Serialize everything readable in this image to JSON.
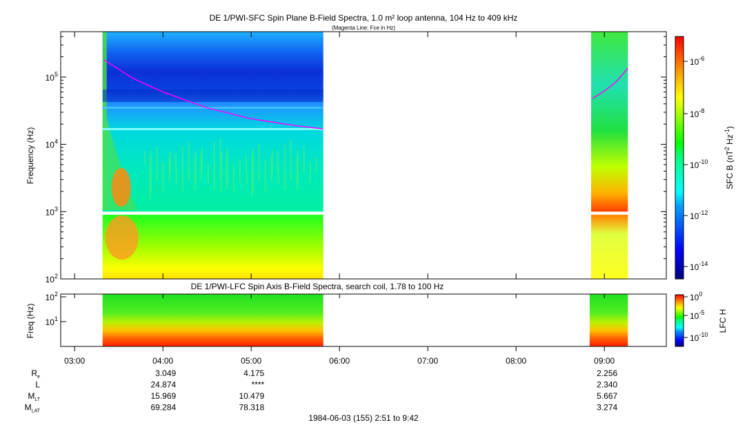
{
  "chart_data": [
    {
      "type": "heatmap",
      "title": "DE 1/PWI-SFC  Spin Plane B-Field Spectra, 1.0 m² loop antenna, 104 Hz to 409 kHz",
      "subtitle": "(Magenta Line: Fce in Hz)",
      "ylabel": "Frequency (Hz)",
      "yscale": "log",
      "ylim": [
        100,
        409000
      ],
      "ytick_labels": [
        "10^2",
        "10^3",
        "10^4",
        "10^5"
      ],
      "ytick_values": [
        100,
        1000,
        10000,
        100000
      ],
      "data_intervals": [
        [
          "03:19",
          "05:49"
        ],
        [
          "08:51",
          "09:16"
        ]
      ],
      "gap_hz": [
        900,
        1000
      ],
      "fce_line": {
        "color": "#ff00ff",
        "segments": [
          [
            [
              "03:20",
              180000
            ],
            [
              "03:40",
              95000
            ],
            [
              "04:00",
              60000
            ],
            [
              "04:30",
              35000
            ],
            [
              "05:00",
              24000
            ],
            [
              "05:30",
              19000
            ],
            [
              "05:49",
              17000
            ]
          ],
          [
            [
              "08:52",
              48000
            ],
            [
              "09:00",
              62000
            ],
            [
              "09:08",
              85000
            ],
            [
              "09:16",
              135000
            ]
          ]
        ]
      },
      "colorbar": {
        "label": "SFC B (nT² Hz⁻¹)",
        "label_main": "SFC B (nT",
        "label_sup1": "2",
        "label_mid": " Hz",
        "label_sup2": "-1",
        "label_end": ")",
        "scale": "log",
        "range": [
          1e-15,
          1e-05
        ],
        "tick_labels": [
          "10^-6",
          "10^-8",
          "10^-10",
          "10^-12",
          "10^-14"
        ]
      }
    },
    {
      "type": "heatmap",
      "title": "DE 1/PWI-LFC  Spin Axis B-Field Spectra, search coil, 1.78 to 100 Hz",
      "ylabel": "Freq (Hz)",
      "yscale": "log",
      "ylim": [
        1.78,
        100
      ],
      "ytick_labels": [
        "10^2",
        "10^1"
      ],
      "data_intervals": [
        [
          "03:19",
          "05:49"
        ],
        [
          "08:50",
          "09:16"
        ]
      ],
      "colorbar": {
        "label": "LFC H",
        "scale": "log",
        "range": [
          1e-12,
          1
        ],
        "tick_labels": [
          "10^0",
          "10^-5",
          "10^-10"
        ]
      }
    }
  ],
  "xaxis": {
    "range": [
      "02:51",
      "09:42"
    ],
    "tick_labels": [
      "03:00",
      "04:00",
      "05:00",
      "06:00",
      "07:00",
      "08:00",
      "09:00"
    ]
  },
  "ephemeris": {
    "rows": [
      {
        "label": "R",
        "sub": "e",
        "values": [
          "",
          "3.049",
          "4.175",
          "",
          "",
          "",
          "2.256"
        ]
      },
      {
        "label": "L",
        "sub": "",
        "values": [
          "",
          "24.874",
          "****",
          "",
          "",
          "",
          "2.340"
        ]
      },
      {
        "label": "M",
        "sub": "LT",
        "values": [
          "",
          "15.969",
          "10.479",
          "",
          "",
          "",
          "5.667"
        ]
      },
      {
        "label": "M",
        "sub": "LAT",
        "values": [
          "",
          "69.284",
          "78.318",
          "",
          "",
          "",
          "3.274"
        ]
      }
    ]
  },
  "footer": "1984-06-03 (155) 2:51 to 9:42"
}
